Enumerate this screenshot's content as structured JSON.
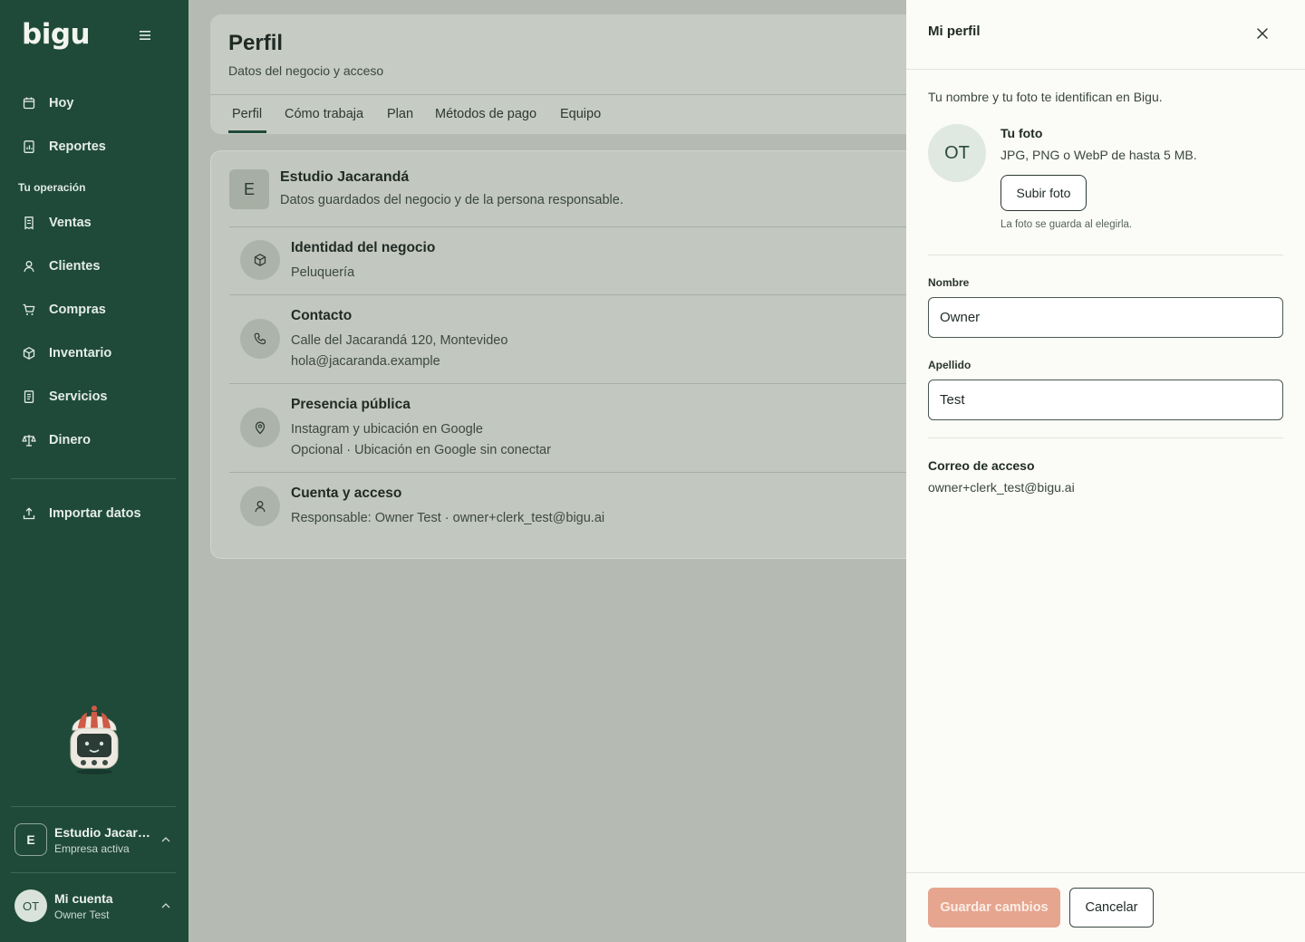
{
  "app": {
    "logo": "bigu"
  },
  "sidebar": {
    "top_items": [
      {
        "label": "Hoy",
        "icon": "calendar-icon"
      },
      {
        "label": "Reportes",
        "icon": "report-icon"
      }
    ],
    "section_title": "Tu operación",
    "items": [
      {
        "label": "Ventas",
        "icon": "receipt-icon"
      },
      {
        "label": "Clientes",
        "icon": "user-icon"
      },
      {
        "label": "Compras",
        "icon": "cart-icon"
      },
      {
        "label": "Inventario",
        "icon": "box-icon"
      },
      {
        "label": "Servicios",
        "icon": "document-icon"
      },
      {
        "label": "Dinero",
        "icon": "scale-icon"
      }
    ],
    "import_label": "Importar datos",
    "company": {
      "badge": "E",
      "name": "Estudio Jacarandá",
      "status": "Empresa activa"
    },
    "account": {
      "initials": "OT",
      "title": "Mi cuenta",
      "name": "Owner Test"
    }
  },
  "page": {
    "title": "Perfil",
    "subtitle": "Datos del negocio y acceso",
    "tabs": [
      "Perfil",
      "Cómo trabaja",
      "Plan",
      "Métodos de pago",
      "Equipo"
    ],
    "active_tab": "Perfil"
  },
  "business": {
    "badge": "E",
    "name": "Estudio Jacarandá",
    "description": "Datos guardados del negocio y de la persona responsable.",
    "sections": [
      {
        "title": "Identidad del negocio",
        "lines": [
          "Peluquería"
        ],
        "icon": "box-icon"
      },
      {
        "title": "Contacto",
        "lines": [
          "Calle del Jacarandá 120, Montevideo",
          "hola@jacaranda.example"
        ],
        "icon": "phone-icon"
      },
      {
        "title": "Presencia pública",
        "lines": [
          "Instagram y ubicación en Google",
          "Opcional · Ubicación en Google sin conectar"
        ],
        "icon": "location-pin-icon"
      },
      {
        "title": "Cuenta y acceso",
        "lines": [
          "Responsable: Owner Test · owner+clerk_test@bigu.ai"
        ],
        "icon": "user-icon"
      }
    ]
  },
  "drawer": {
    "title": "Mi perfil",
    "intro": "Tu nombre y tu foto te identifican en Bigu.",
    "avatar_initials": "OT",
    "photo_label": "Tu foto",
    "photo_hint": "JPG, PNG o WebP de hasta 5 MB.",
    "upload_label": "Subir foto",
    "photo_note": "La foto se guarda al elegirla.",
    "first_name_label": "Nombre",
    "first_name_value": "Owner",
    "last_name_label": "Apellido",
    "last_name_value": "Test",
    "email_label": "Correo de acceso",
    "email_value": "owner+clerk_test@bigu.ai",
    "save_label": "Guardar cambios",
    "cancel_label": "Cancelar"
  },
  "colors": {
    "sidebar_bg": "#1f4a3a",
    "accent_save": "#e6a58f",
    "drawer_bg": "#fbfbf7"
  }
}
